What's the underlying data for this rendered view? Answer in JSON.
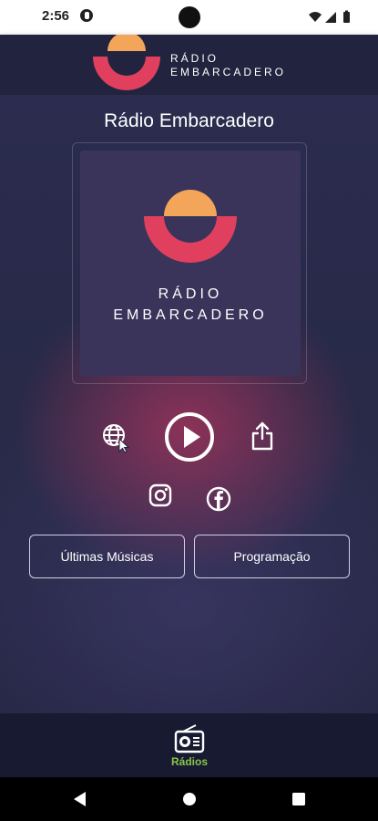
{
  "status_bar": {
    "time": "2:56"
  },
  "header": {
    "brand_line1": "RÁDIO",
    "brand_line2": "EMBARCADERO"
  },
  "main": {
    "station_title": "Rádio Embarcadero",
    "artwork": {
      "line1": "RÁDIO",
      "line2": "EMBARCADERO"
    },
    "buttons": {
      "recent_songs": "Últimas Músicas",
      "schedule": "Programação"
    }
  },
  "bottom_nav": {
    "items": [
      {
        "label": "Rádios",
        "icon": "radio-icon",
        "active": true
      }
    ]
  },
  "colors": {
    "background": "#22243f",
    "logo_red": "#e0405e",
    "logo_orange": "#f3a55a",
    "active_nav": "#8bc34a",
    "artwork_bg": "#3a345a"
  }
}
